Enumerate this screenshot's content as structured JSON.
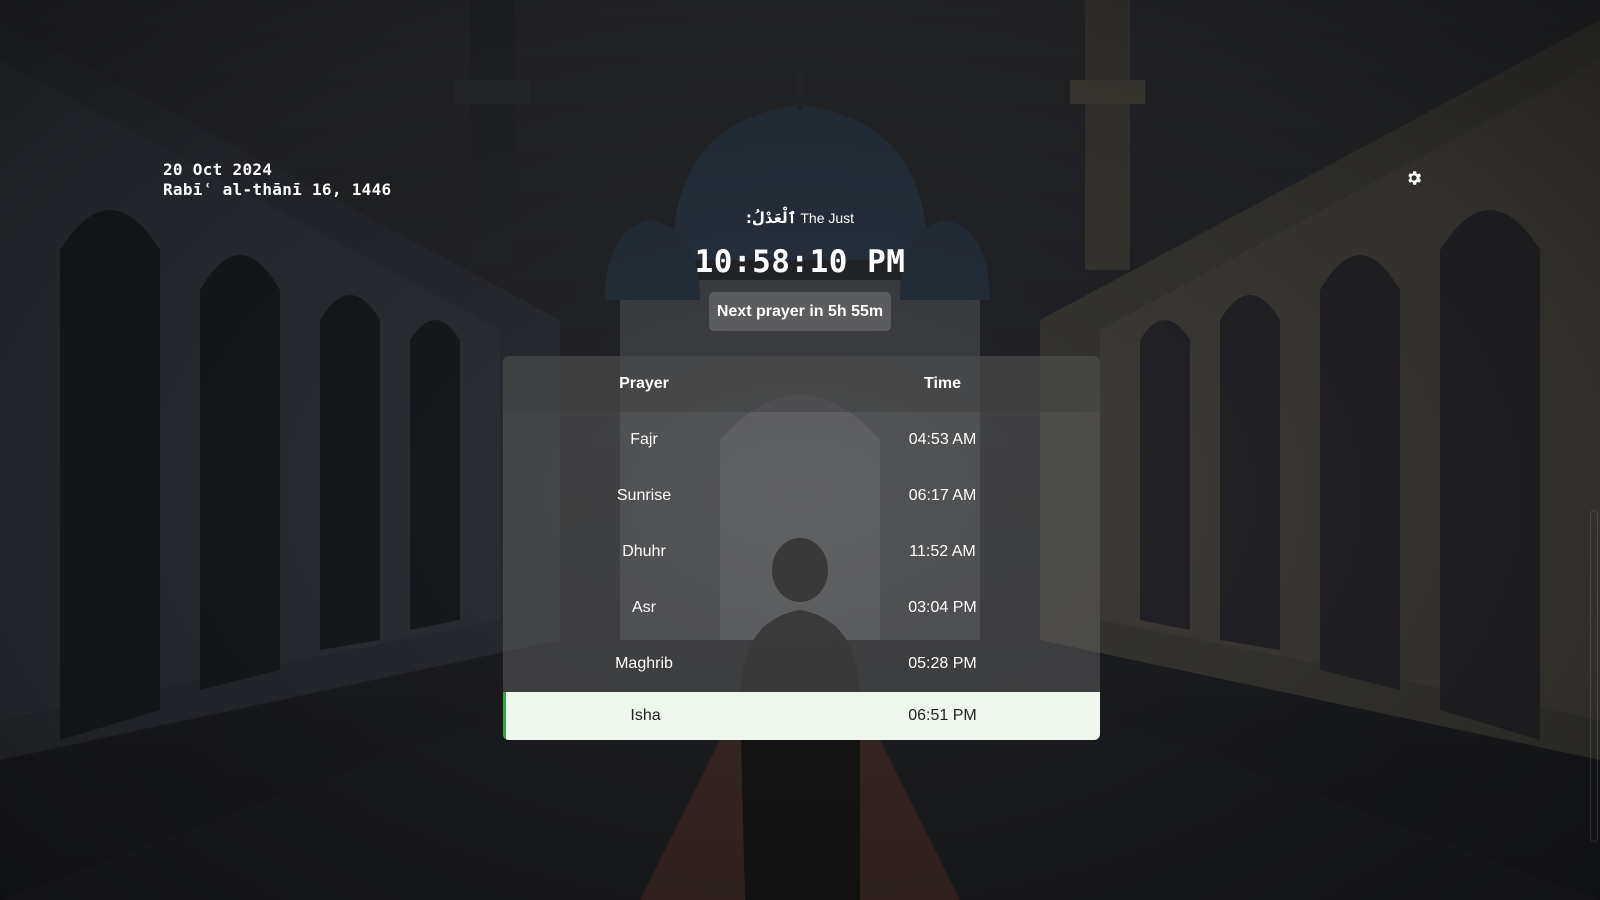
{
  "date": {
    "gregorian": "20 Oct 2024",
    "hijri": "Rabīʿ al-thānī 16, 1446"
  },
  "name_of_allah": {
    "arabic": "ٱلْعَدْلُ:",
    "english": "The Just"
  },
  "clock": {
    "time": "10:58:10 PM"
  },
  "next_prayer": {
    "label": "Next prayer in 5h 55m"
  },
  "table": {
    "headers": [
      "Prayer",
      "Time"
    ],
    "rows": [
      {
        "prayer": "Fajr",
        "time": "04:53 AM"
      },
      {
        "prayer": "Sunrise",
        "time": "06:17 AM"
      },
      {
        "prayer": "Dhuhr",
        "time": "11:52 AM"
      },
      {
        "prayer": "Asr",
        "time": "03:04 PM"
      },
      {
        "prayer": "Maghrib",
        "time": "05:28 PM"
      },
      {
        "prayer": "Isha",
        "time": "06:51 PM",
        "current": true
      }
    ]
  },
  "icons": {
    "settings": "gear-icon"
  },
  "colors": {
    "current_highlight_bg": "#eef6ee",
    "current_highlight_bar": "#2eaa3c"
  }
}
